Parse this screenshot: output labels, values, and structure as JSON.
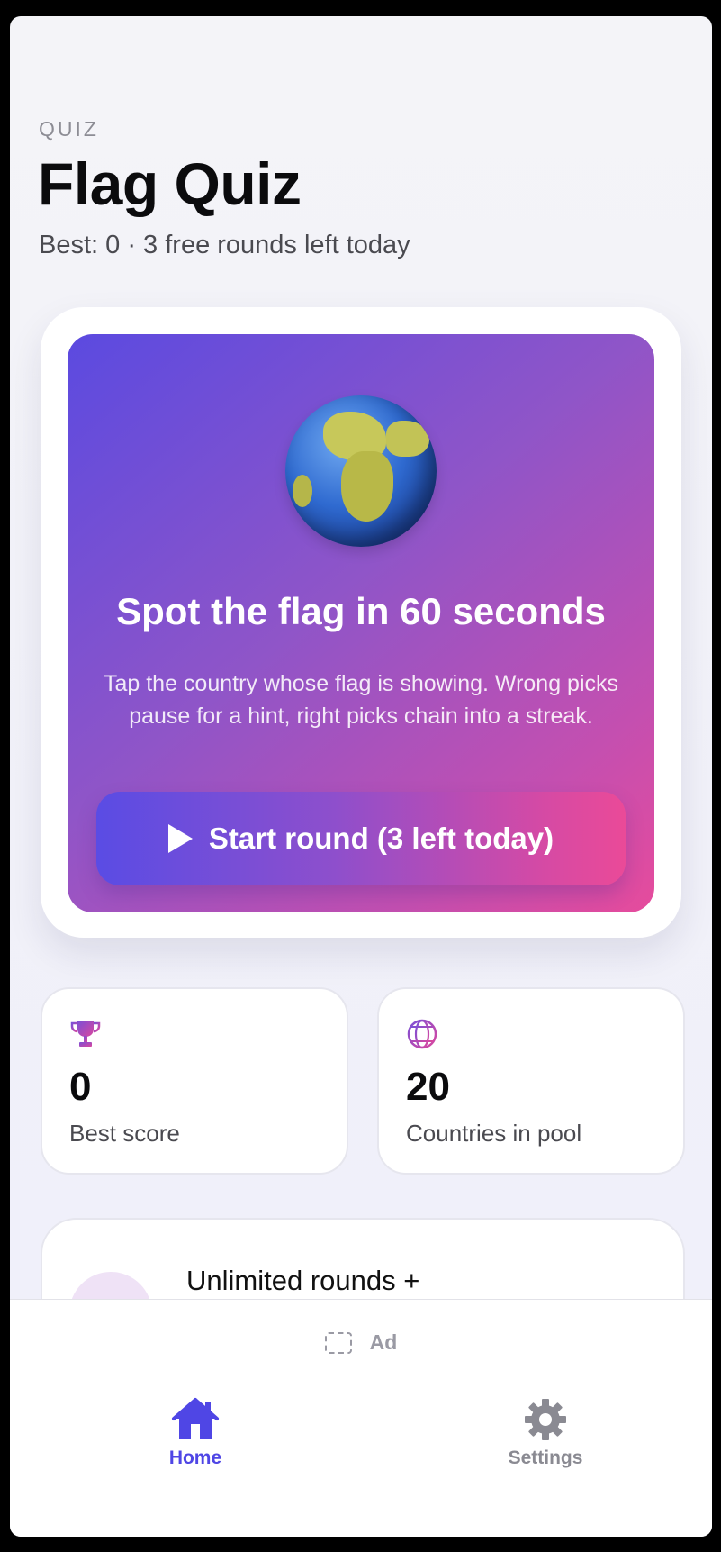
{
  "header": {
    "eyebrow": "QUIZ",
    "title": "Flag Quiz",
    "subtitle": "Best: 0 · 3 free rounds left today"
  },
  "hero": {
    "icon": "globe-emoji",
    "headline": "Spot the flag in 60 seconds",
    "description": "Tap the country whose flag is showing. Wrong picks pause for a hint, right picks chain into a streak.",
    "start_button_label": "Start round (3 left today)"
  },
  "stats": [
    {
      "icon": "trophy-icon",
      "value": "0",
      "label": "Best score"
    },
    {
      "icon": "globe-icon",
      "value": "20",
      "label": "Countries in pool"
    }
  ],
  "promo": {
    "text": "Unlimited rounds + bigger pack"
  },
  "ad": {
    "label": "Ad"
  },
  "tabs": [
    {
      "label": "Home",
      "icon": "home-icon",
      "active": true
    },
    {
      "label": "Settings",
      "icon": "gear-icon",
      "active": false
    }
  ],
  "colors": {
    "accent": "#4f46e5",
    "gradient_start": "#5b4ae0",
    "gradient_end": "#e64b9c",
    "inactive_tab": "#8a8a92"
  }
}
